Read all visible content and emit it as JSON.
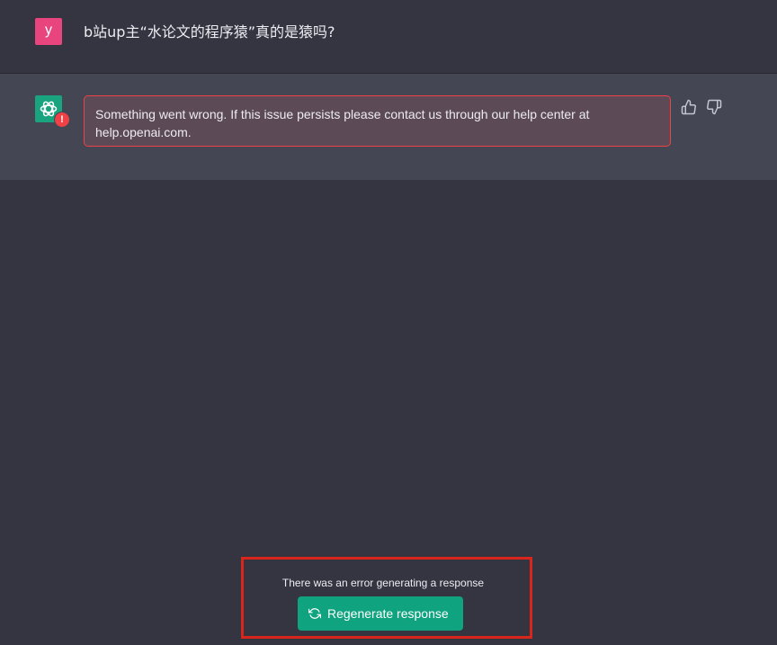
{
  "user_message": {
    "avatar_letter": "y",
    "avatar_color": "#e8457f",
    "text": "b站up主“水论文的程序猿”真的是猿吗?"
  },
  "assistant_message": {
    "avatar_icon": "openai-logo-icon",
    "avatar_color": "#19a37f",
    "error_badge": "!",
    "error_text": "Something went wrong. If this issue persists please contact us through our help center at help.openai.com.",
    "feedback": {
      "up_icon": "thumbs-up-icon",
      "down_icon": "thumbs-down-icon"
    }
  },
  "error_panel": {
    "message": "There was an error generating a response",
    "button_label": "Regenerate response",
    "button_icon": "refresh-icon",
    "button_color": "#10a37f",
    "highlight_color": "#d9261c"
  }
}
